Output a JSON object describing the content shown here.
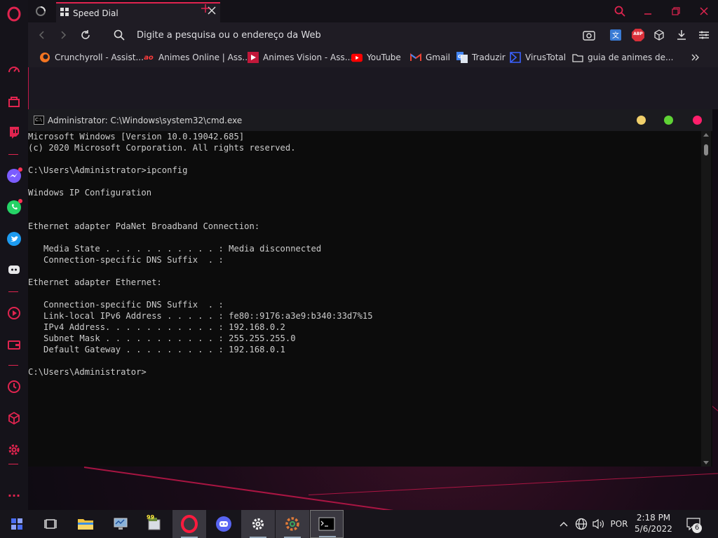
{
  "browser": {
    "tab_title": "Speed Dial",
    "address_placeholder": "Digite a pesquisa ou o endereço da Web",
    "extension_abp": "ABP",
    "bookmarks": [
      {
        "label": "Crunchyroll - Assist...",
        "icon": "crunchyroll-icon"
      },
      {
        "label": "Animes Online | Ass...",
        "icon": "animes-online-icon",
        "badge": "ao"
      },
      {
        "label": "Animes Vision - Ass...",
        "icon": "animes-vision-icon"
      },
      {
        "label": "YouTube",
        "icon": "youtube-icon"
      },
      {
        "label": "Gmail",
        "icon": "gmail-icon"
      },
      {
        "label": "Traduzir",
        "icon": "translate-icon"
      },
      {
        "label": "VirusTotal",
        "icon": "virustotal-icon"
      },
      {
        "label": "guia de animes de...",
        "icon": "folder-icon"
      }
    ]
  },
  "cmd": {
    "title": "Administrator: C:\\Windows\\system32\\cmd.exe",
    "lines": [
      "Microsoft Windows [Version 10.0.19042.685]",
      "(c) 2020 Microsoft Corporation. All rights reserved.",
      "",
      "C:\\Users\\Administrator>ipconfig",
      "",
      "Windows IP Configuration",
      "",
      "",
      "Ethernet adapter PdaNet Broadband Connection:",
      "",
      "   Media State . . . . . . . . . . . : Media disconnected",
      "   Connection-specific DNS Suffix  . :",
      "",
      "Ethernet adapter Ethernet:",
      "",
      "   Connection-specific DNS Suffix  . :",
      "   Link-local IPv6 Address . . . . . : fe80::9176:a3e9:b340:33d7%15",
      "   IPv4 Address. . . . . . . . . . . : 192.168.0.2",
      "   Subnet Mask . . . . . . . . . . . : 255.255.255.0",
      "   Default Gateway . . . . . . . . . : 192.168.0.1",
      "",
      "C:\\Users\\Administrator>"
    ]
  },
  "taskbar": {
    "language": "POR",
    "time": "2:18 PM",
    "date": "5/6/2022",
    "notification_count": "6",
    "notepad_badge": "99"
  },
  "colors": {
    "accent": "#e0244f",
    "console_bg": "#0c0c0c",
    "console_text": "#cccccc",
    "light_yellow": "#f0cf6a",
    "light_green": "#5fd335",
    "light_red": "#ff1f6b"
  }
}
